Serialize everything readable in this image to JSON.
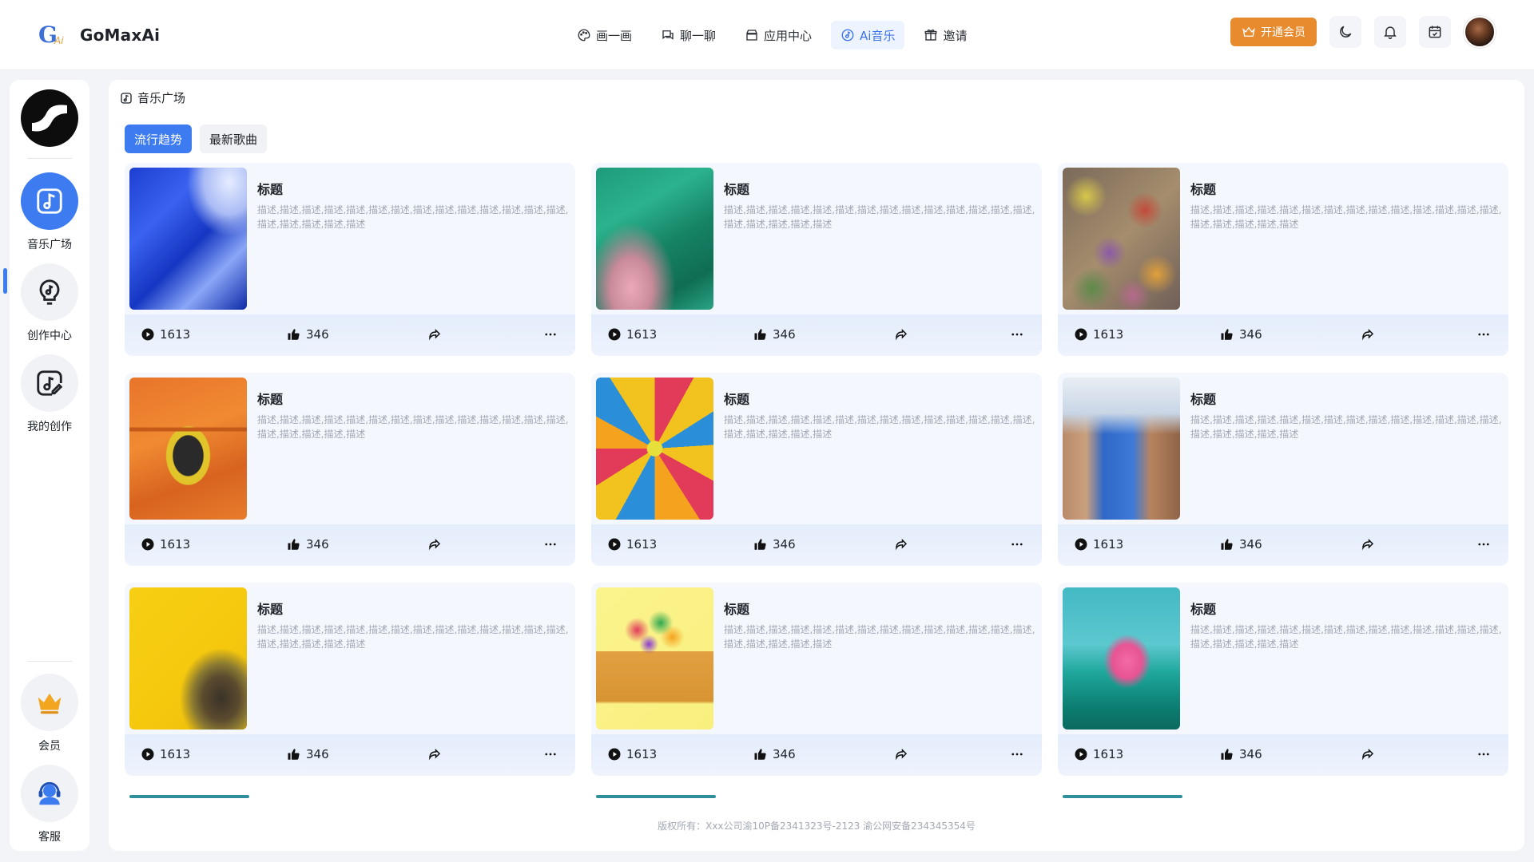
{
  "app": {
    "name": "GoMaxAi"
  },
  "nav": {
    "items": [
      {
        "label": "画一画",
        "icon": "palette-icon"
      },
      {
        "label": "聊一聊",
        "icon": "chat-icon"
      },
      {
        "label": "应用中心",
        "icon": "store-icon"
      },
      {
        "label": "Ai音乐",
        "icon": "music-disc-icon",
        "active": true
      },
      {
        "label": "邀请",
        "icon": "gift-icon"
      }
    ]
  },
  "header": {
    "vip_label": "开通会员"
  },
  "sidebar": {
    "items": [
      {
        "label": "音乐广场",
        "icon": "music-note-icon",
        "active": true
      },
      {
        "label": "创作中心",
        "icon": "music-bulb-icon"
      },
      {
        "label": "我的创作",
        "icon": "music-edit-icon"
      },
      {
        "label": "会员",
        "icon": "crown-icon"
      },
      {
        "label": "客服",
        "icon": "headset-icon"
      }
    ]
  },
  "page": {
    "title": "音乐广场",
    "tabs": [
      {
        "label": "流行趋势",
        "active": true
      },
      {
        "label": "最新歌曲",
        "active": false
      }
    ]
  },
  "cards": [
    {
      "title": "标题",
      "desc": "描述,描述,描述,描述,描述,描述,描述,描述,描述,描述,描述,描述,描述,描述,描述,描述,描述,描述,描述",
      "plays": "1613",
      "likes": "346",
      "image": "blue-abstract"
    },
    {
      "title": "标题",
      "desc": "描述,描述,描述,描述,描述,描述,描述,描述,描述,描述,描述,描述,描述,描述,描述,描述,描述,描述,描述",
      "plays": "1613",
      "likes": "346",
      "image": "green-leaf"
    },
    {
      "title": "标题",
      "desc": "描述,描述,描述,描述,描述,描述,描述,描述,描述,描述,描述,描述,描述,描述,描述,描述,描述,描述,描述",
      "plays": "1613",
      "likes": "346",
      "image": "autumn-leaves"
    },
    {
      "title": "标题",
      "desc": "描述,描述,描述,描述,描述,描述,描述,描述,描述,描述,描述,描述,描述,描述,描述,描述,描述,描述,描述",
      "plays": "1613",
      "likes": "346",
      "image": "orange-window"
    },
    {
      "title": "标题",
      "desc": "描述,描述,描述,描述,描述,描述,描述,描述,描述,描述,描述,描述,描述,描述,描述,描述,描述,描述,描述",
      "plays": "1613",
      "likes": "346",
      "image": "balloon-pattern"
    },
    {
      "title": "标题",
      "desc": "描述,描述,描述,描述,描述,描述,描述,描述,描述,描述,描述,描述,描述,描述,描述,描述,描述,描述,描述",
      "plays": "1613",
      "likes": "346",
      "image": "blue-alley"
    },
    {
      "title": "标题",
      "desc": "描述,描述,描述,描述,描述,描述,描述,描述,描述,描述,描述,描述,描述,描述,描述,描述,描述,描述,描述",
      "plays": "1613",
      "likes": "346",
      "image": "yellow-wall"
    },
    {
      "title": "标题",
      "desc": "描述,描述,描述,描述,描述,描述,描述,描述,描述,描述,描述,描述,描述,描述,描述,描述,描述,描述,描述",
      "plays": "1613",
      "likes": "346",
      "image": "paper-cone"
    },
    {
      "title": "标题",
      "desc": "描述,描述,描述,描述,描述,描述,描述,描述,描述,描述,描述,描述,描述,描述,描述,描述,描述,描述,描述",
      "plays": "1613",
      "likes": "346",
      "image": "flamingo-float"
    }
  ],
  "footer": {
    "text": "版权所有：Xxx公司渝10P备2341323号-2123 渝公网安备234345354号"
  },
  "colors": {
    "accent": "#3d7bf0",
    "vip": "#e88a2e"
  }
}
